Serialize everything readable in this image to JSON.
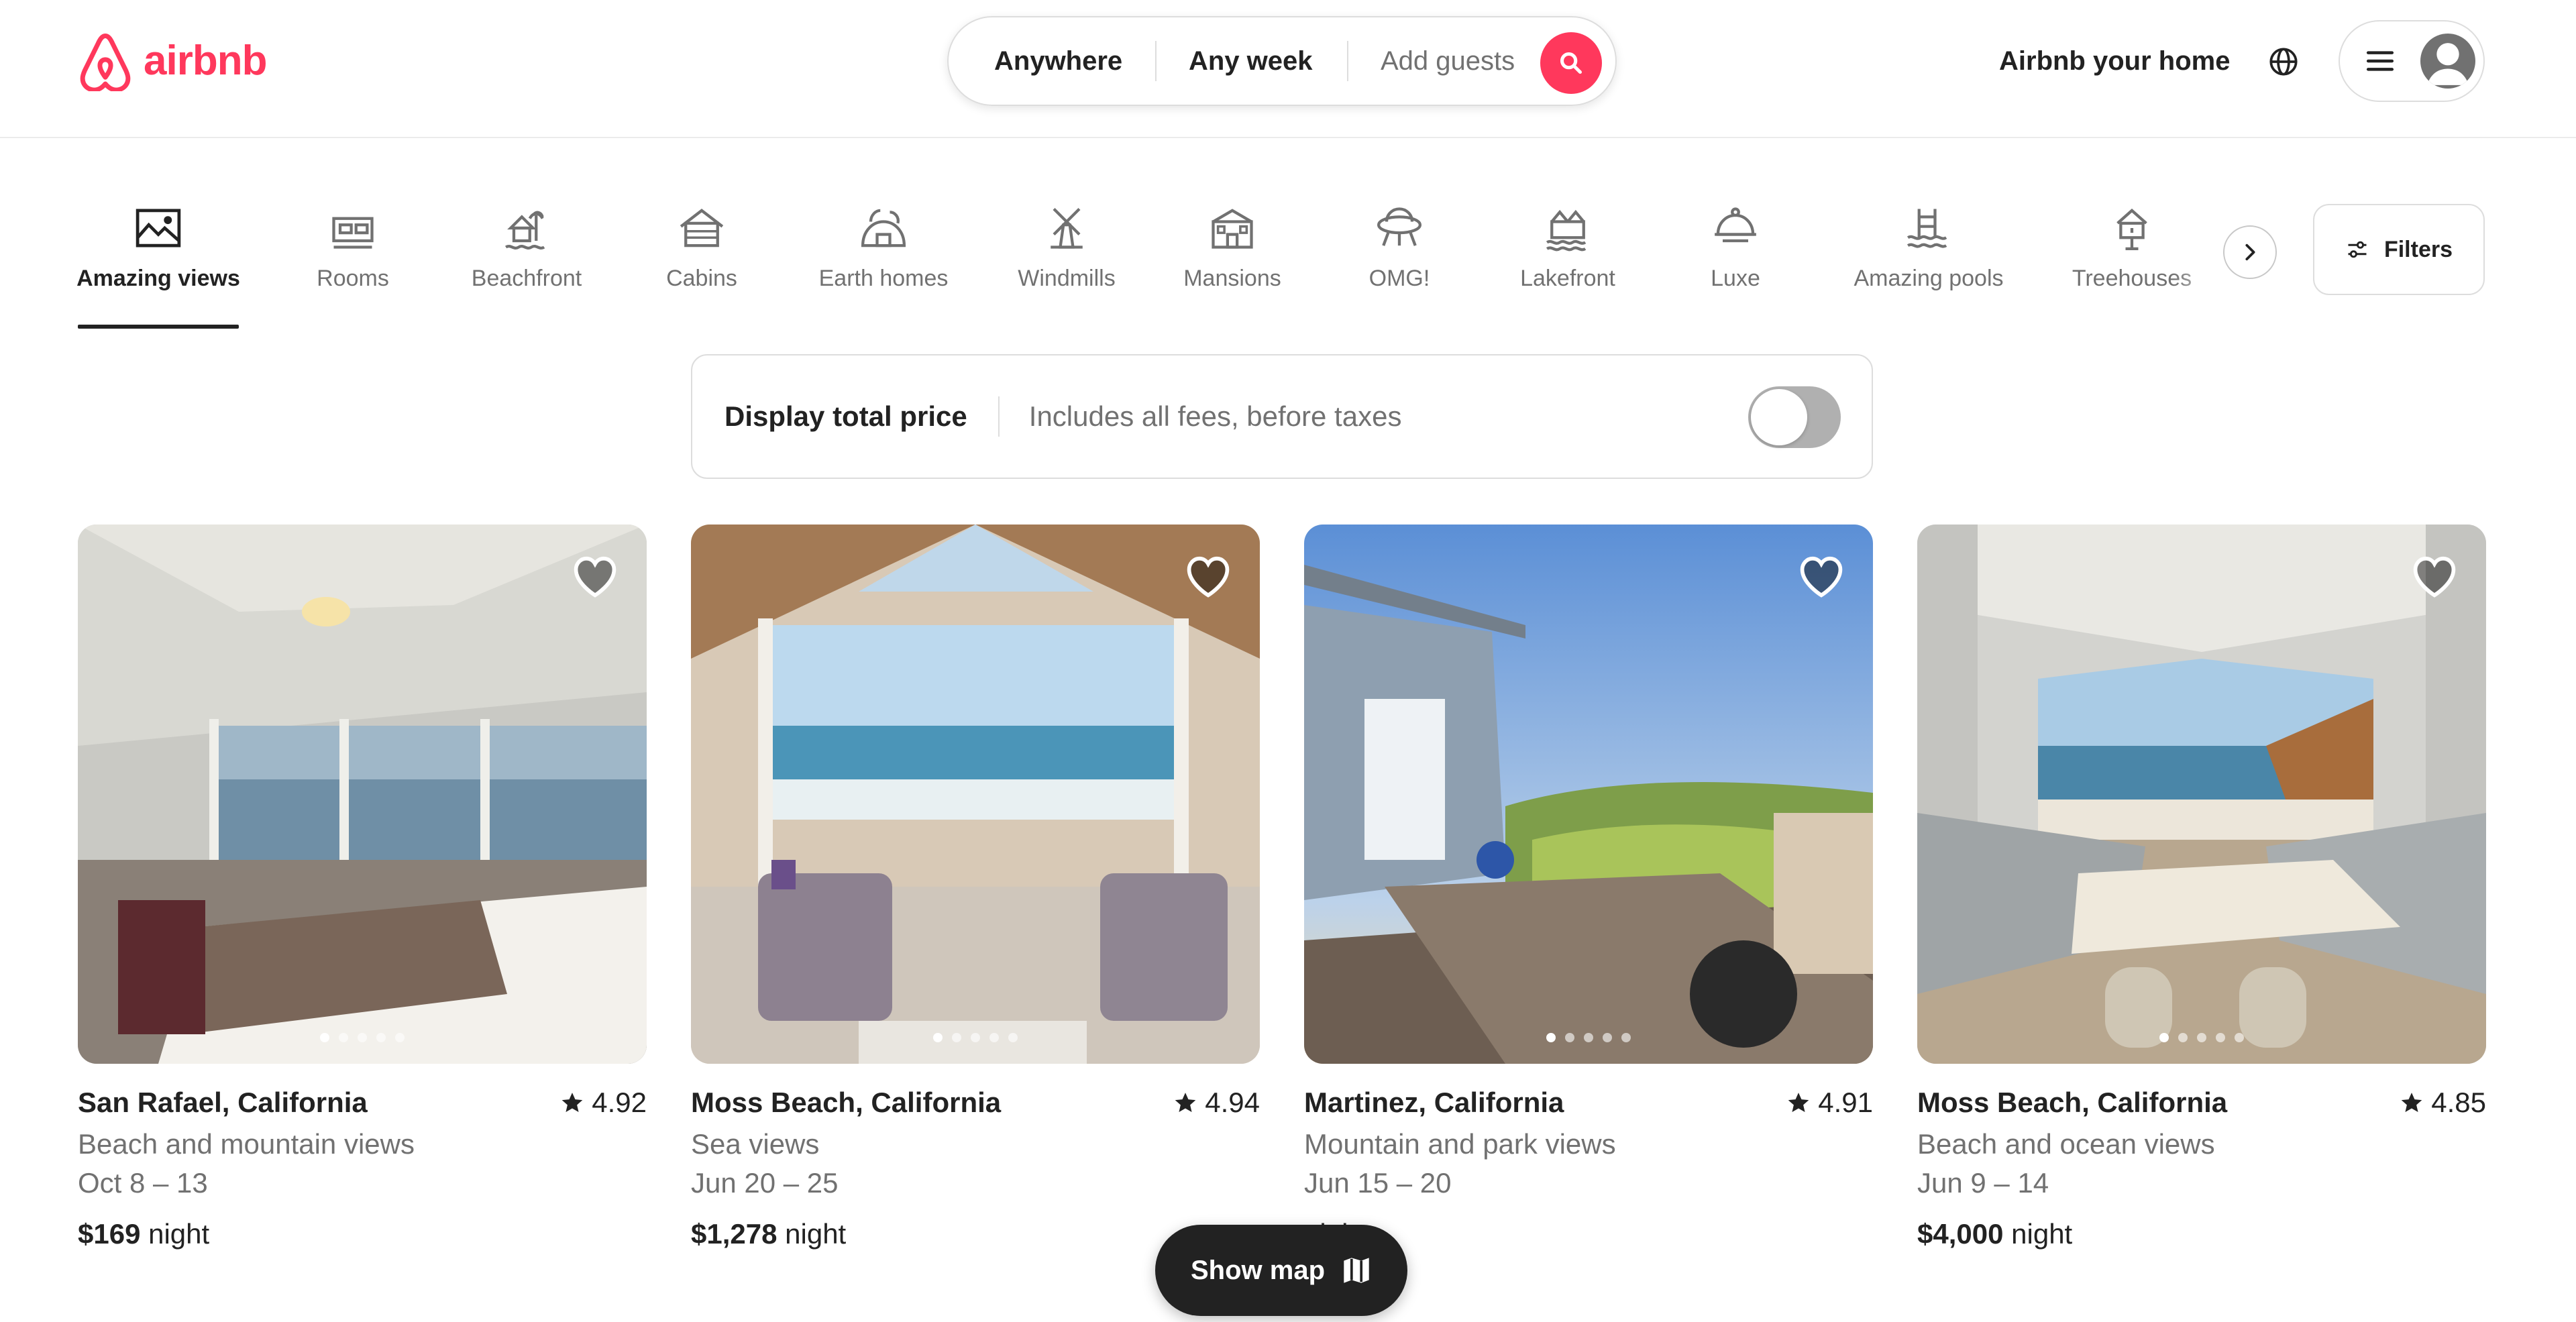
{
  "brand": {
    "name": "airbnb",
    "color": "#ff385c"
  },
  "search": {
    "where": "Anywhere",
    "week": "Any week",
    "guests_placeholder": "Add guests",
    "search_icon": "search-icon"
  },
  "header": {
    "host_link": "Airbnb your home",
    "globe_icon": "globe-icon",
    "menu_icon": "hamburger-icon",
    "avatar_icon": "user-avatar-icon"
  },
  "categories": {
    "items": [
      {
        "label": "Amazing views",
        "icon": "amazing-views-icon",
        "active": true
      },
      {
        "label": "Rooms",
        "icon": "rooms-icon"
      },
      {
        "label": "Beachfront",
        "icon": "beachfront-icon"
      },
      {
        "label": "Cabins",
        "icon": "cabins-icon"
      },
      {
        "label": "Earth homes",
        "icon": "earth-homes-icon"
      },
      {
        "label": "Windmills",
        "icon": "windmills-icon"
      },
      {
        "label": "Mansions",
        "icon": "mansions-icon"
      },
      {
        "label": "OMG!",
        "icon": "omg-icon"
      },
      {
        "label": "Lakefront",
        "icon": "lakefront-icon"
      },
      {
        "label": "Luxe",
        "icon": "luxe-icon"
      },
      {
        "label": "Amazing pools",
        "icon": "amazing-pools-icon"
      },
      {
        "label": "Treehouses",
        "icon": "treehouses-icon"
      }
    ],
    "next_icon": "chevron-right-icon",
    "filters_label": "Filters"
  },
  "total_price": {
    "title": "Display total price",
    "subtitle": "Includes all fees, before taxes",
    "enabled": false
  },
  "listings": [
    {
      "location": "San Rafael, California",
      "rating": "4.92",
      "description": "Beach and mountain views",
      "dates": "Oct 8 – 13",
      "price": "$169",
      "unit": "night",
      "photo_index": 0,
      "photo_count": 5
    },
    {
      "location": "Moss Beach, California",
      "rating": "4.94",
      "description": "Sea views",
      "dates": "Jun 20 – 25",
      "price": "$1,278",
      "unit": "night",
      "photo_index": 0,
      "photo_count": 5
    },
    {
      "location": "Martinez, California",
      "rating": "4.91",
      "description": "Mountain and park views",
      "dates": "Jun 15 – 20",
      "price": "",
      "unit": "night",
      "photo_index": 0,
      "photo_count": 5
    },
    {
      "location": "Moss Beach, California",
      "rating": "4.85",
      "description": "Beach and ocean views",
      "dates": "Jun 9 – 14",
      "price": "$4,000",
      "unit": "night",
      "photo_index": 0,
      "photo_count": 5
    }
  ],
  "show_map": {
    "label": "Show map",
    "icon": "map-icon"
  }
}
